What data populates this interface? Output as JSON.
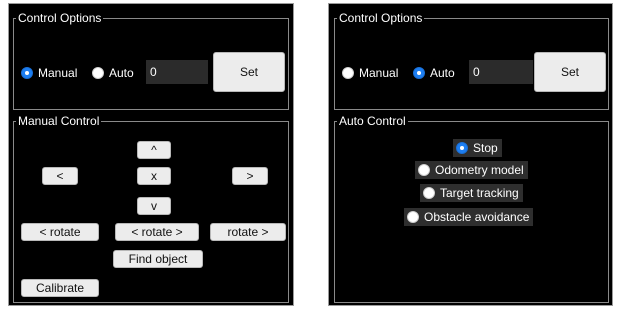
{
  "left_panel": {
    "control_options": {
      "title": "Control Options",
      "manual_label": "Manual",
      "auto_label": "Auto",
      "selected_mode": "Manual",
      "value": "0",
      "set_label": "Set"
    },
    "manual_control": {
      "title": "Manual Control",
      "up_label": "^",
      "left_label": "<",
      "stop_label": "x",
      "right_label": ">",
      "down_label": "v",
      "rotate_left_label": "< rotate",
      "rotate_both_label": "< rotate >",
      "rotate_right_label": "rotate >",
      "find_object_label": "Find object",
      "calibrate_label": "Calibrate"
    }
  },
  "right_panel": {
    "control_options": {
      "title": "Control Options",
      "manual_label": "Manual",
      "auto_label": "Auto",
      "selected_mode": "Auto",
      "value": "0",
      "set_label": "Set"
    },
    "auto_control": {
      "title": "Auto Control",
      "options": [
        {
          "label": "Stop",
          "selected": true
        },
        {
          "label": "Odometry model",
          "selected": false
        },
        {
          "label": "Target tracking",
          "selected": false
        },
        {
          "label": "Obstacle avoidance",
          "selected": false
        }
      ]
    }
  },
  "colors": {
    "panel_bg": "#000000",
    "radio_selected": "#1c7ef2",
    "button_bg": "#ececec",
    "field_bg": "#2b2b2b"
  }
}
